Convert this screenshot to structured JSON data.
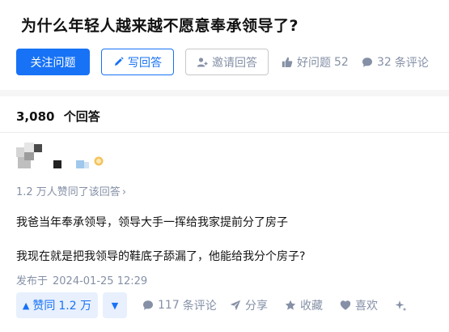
{
  "question": {
    "title": "为什么年轻人越来越不愿意奉承领导了?"
  },
  "actions": {
    "follow_label": "关注问题",
    "write_label": "写回答",
    "invite_label": "邀请回答",
    "good_label": "好问题",
    "good_count": "52",
    "comment_count": "32",
    "comment_label": "条评论"
  },
  "answers_header": {
    "count": "3,080",
    "label": "个回答"
  },
  "answer": {
    "agree_text": "1.2 万人赞同了该回答",
    "chevron": "›",
    "paragraphs": [
      "我爸当年奉承领导，领导大手一挥给我家提前分了房子",
      "我现在就是把我领导的鞋底子舔漏了，他能给我分个房子?"
    ],
    "post_label": "发布于",
    "post_time": "2024-01-25 12:29"
  },
  "bottom_bar": {
    "upvote_glyph": "▲",
    "upvote_label": "赞同",
    "upvote_count": "1.2 万",
    "downvote_glyph": "▼",
    "comment_count": "117",
    "comment_label": "条评论",
    "share_label": "分享",
    "favorite_label": "收藏",
    "like_label": "喜欢"
  },
  "colors": {
    "brand_blue": "#1772f6",
    "muted_gray": "#8590a6",
    "text": "#121212",
    "vote_bg": "#e8f0fd"
  },
  "icons": [
    "pencil-icon",
    "invite-user-icon",
    "thumbs-up-icon",
    "comment-bubble-icon",
    "share-paper-plane-icon",
    "star-icon",
    "heart-icon",
    "sparkle-icon",
    "badge-icon"
  ]
}
